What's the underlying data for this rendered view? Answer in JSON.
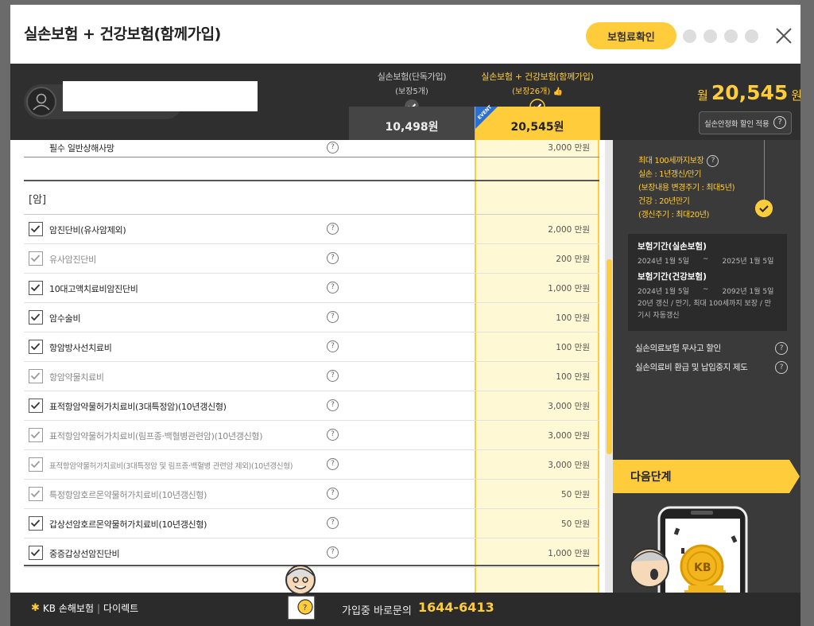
{
  "header": {
    "title": "실손보험 + 건강보험(함께가입)",
    "premium_check_label": "보험료확인"
  },
  "plans": {
    "single": {
      "name": "실손보험(단독가입)",
      "count": "(보장5개)",
      "price": "10,498원"
    },
    "combo": {
      "name": "실손보험 + 건강보험(함께가입)",
      "count": "(보장26개)",
      "price": "20,545원",
      "badge": "EVENT"
    }
  },
  "total": {
    "prefix": "월",
    "amount": "20,545",
    "suffix": "원",
    "discount_label": "실손안정화 할인 적용"
  },
  "top_row": {
    "label": "필수 일반상해사망",
    "amount": "3,000 만원"
  },
  "section": {
    "label": "[암]"
  },
  "coverages": [
    {
      "label": "암진단비(유사암제외)",
      "amount": "2,000 만원",
      "muted": false
    },
    {
      "label": "유사암진단비",
      "amount": "200 만원",
      "muted": true
    },
    {
      "label": "10대고액치료비암진단비",
      "amount": "1,000 만원",
      "muted": false
    },
    {
      "label": "암수술비",
      "amount": "100 만원",
      "muted": false
    },
    {
      "label": "항암방사선치료비",
      "amount": "100 만원",
      "muted": false
    },
    {
      "label": "항암약물치료비",
      "amount": "100 만원",
      "muted": true
    },
    {
      "label": "표적항암약물허가치료비(3대특정암)(10년갱신형)",
      "amount": "3,000 만원",
      "muted": false
    },
    {
      "label": "표적항암약물허가치료비(림프종·백혈병관련암)(10년갱신형)",
      "amount": "3,000 만원",
      "muted": true
    },
    {
      "label": "표적항암약물허가치료비(3대특정암 및 림프종·백혈병 관련암 제외)(10년갱신형)",
      "amount": "3,000 만원",
      "muted": true,
      "small": true
    },
    {
      "label": "특정항암호르몬약물허가치료비(10년갱신형)",
      "amount": "50 만원",
      "muted": true
    },
    {
      "label": "갑상선암호르몬약물허가치료비(10년갱신형)",
      "amount": "50 만원",
      "muted": false
    },
    {
      "label": "중증갑상선암진단비",
      "amount": "1,000 만원",
      "muted": false
    }
  ],
  "info": {
    "feature_head": "최대 100세까지보장",
    "lines": [
      "실손 : 1년갱신/만기",
      "(보장내용 변경주기 : 최대5년)",
      "건강 : 20년만기",
      "(갱신주기 : 최대20년)"
    ],
    "period_silson_title": "보험기간(실손보험)",
    "period_silson_start": "2024년 1월 5일",
    "period_silson_end": "2025년 1월 5일",
    "period_health_title": "보험기간(건강보험)",
    "period_health_start": "2024년 1월 5일",
    "period_health_end": "2092년 1월 5일",
    "period_note": "20년 갱신 / 만기, 최대 100세까지 보장 / 만기시 자동갱신",
    "tilde": "~",
    "link1": "실손의료보험 무사고 할인",
    "link2": "실손의료비 환급 및 납입중지 제도",
    "next_step": "다음단계"
  },
  "footer": {
    "brand_name": "KB 손해보험",
    "brand_sep": "|",
    "brand_sub": "다이렉트",
    "call_label": "가입중 바로문의",
    "call_number": "1644-6413"
  },
  "colors": {
    "accent": "#ffcd3c",
    "dark": "#2f2f2f",
    "event": "#2d6fd0"
  }
}
